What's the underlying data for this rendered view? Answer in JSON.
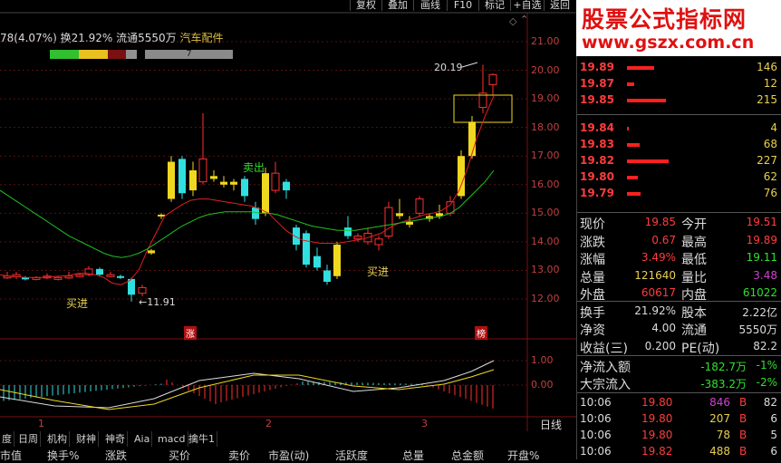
{
  "toolbar": {
    "buttons": [
      "复权",
      "叠加",
      "画线",
      "F10",
      "标记",
      "+自选",
      "返回"
    ]
  },
  "info": {
    "prefix": "78(4.07%) 换21.92% 流通5550万",
    "sector": "汽车配件"
  },
  "strip": {
    "label": "7"
  },
  "price_axis": [
    "21.00",
    "20.00",
    "19.00",
    "18.00",
    "17.00",
    "16.00",
    "15.00",
    "14.00",
    "13.00",
    "12.00"
  ],
  "macd_axis": [
    "1.00",
    "0.00"
  ],
  "annotations": {
    "high": "20.19",
    "low": "11.91",
    "buy1": "买进",
    "sell": "卖出",
    "buy2": "买进",
    "zhang": "涨",
    "bang": "榜"
  },
  "date_marks": [
    "1",
    "2",
    "3"
  ],
  "period_label": "日线",
  "bottom_tabs": [
    "度",
    "日周",
    "机构",
    "财神",
    "神奇",
    "Aia",
    "macd",
    "擒牛1"
  ],
  "columns": [
    "市值",
    "换手%",
    "涨跌",
    "买价",
    "卖价",
    "市盈(动)",
    "活跃度",
    "总量",
    "总金额",
    "开盘%"
  ],
  "logo": {
    "title": "股票公式指标网",
    "url": "www.gszx.com.cn"
  },
  "orderbook": [
    {
      "price": "19.89",
      "bar": 0.3,
      "vol": "146"
    },
    {
      "price": "19.87",
      "bar": 0.08,
      "vol": "12"
    },
    {
      "price": "19.85",
      "bar": 0.43,
      "vol": "215"
    },
    {
      "price": "19.84",
      "bar": 0.02,
      "vol": "4"
    },
    {
      "price": "19.83",
      "bar": 0.14,
      "vol": "68"
    },
    {
      "price": "19.82",
      "bar": 0.46,
      "vol": "227"
    },
    {
      "price": "19.80",
      "bar": 0.12,
      "vol": "62"
    },
    {
      "price": "19.79",
      "bar": 0.15,
      "vol": "76"
    }
  ],
  "quote": [
    {
      "l": "现价",
      "lv": "19.85",
      "lc": "#ff3c3c",
      "r": "今开",
      "rv": "19.51",
      "rc": "#ff3c3c"
    },
    {
      "l": "涨跌",
      "lv": "0.67",
      "lc": "#ff3c3c",
      "r": "最高",
      "rv": "19.89",
      "rc": "#ff3c3c"
    },
    {
      "l": "涨幅",
      "lv": "3.49%",
      "lc": "#ff3c3c",
      "r": "最低",
      "rv": "19.11",
      "rc": "#30e030"
    },
    {
      "l": "总量",
      "lv": "121640",
      "lc": "#e8d050",
      "r": "量比",
      "rv": "3.48",
      "rc": "#d040d0"
    },
    {
      "l": "外盘",
      "lv": "60617",
      "lc": "#ff3c3c",
      "r": "内盘",
      "rv": "61022",
      "rc": "#30e030"
    },
    {
      "l": "换手",
      "lv": "21.92%",
      "lc": "#dcdcdc",
      "r": "股本",
      "rv": "2.22亿",
      "rc": "#dcdcdc"
    },
    {
      "l": "净资",
      "lv": "4.00",
      "lc": "#dcdcdc",
      "r": "流通",
      "rv": "5550万",
      "rc": "#dcdcdc"
    },
    {
      "l": "收益(三)",
      "lv": "0.200",
      "lc": "#dcdcdc",
      "r": "PE(动)",
      "rv": "82.2",
      "rc": "#dcdcdc"
    }
  ],
  "flows": [
    {
      "label": "净流入额",
      "value": "-182.7万",
      "pct": "-1%"
    },
    {
      "label": "大宗流入",
      "value": "-383.2万",
      "pct": "-2%"
    }
  ],
  "ticks": [
    {
      "time": "10:06",
      "price": "19.80",
      "vol": "846",
      "vc": "#d040d0",
      "bs": "B",
      "n": "82"
    },
    {
      "time": "10:06",
      "price": "19.80",
      "vol": "207",
      "vc": "#e8d050",
      "bs": "B",
      "n": "6"
    },
    {
      "time": "10:06",
      "price": "19.80",
      "vol": "78",
      "vc": "#e8d050",
      "bs": "B",
      "n": "5"
    },
    {
      "time": "10:06",
      "price": "19.82",
      "vol": "488",
      "vc": "#e8d050",
      "bs": "B",
      "n": "6"
    }
  ],
  "chart_data": {
    "type": "candlestick",
    "ylim": [
      11.5,
      21.3
    ],
    "ma_red": [
      12.85,
      12.8,
      12.78,
      12.75,
      12.75,
      12.75,
      12.78,
      12.8,
      12.82,
      12.9,
      12.9,
      12.85,
      12.75,
      12.55,
      12.5,
      12.65,
      13.0,
      13.7,
      14.3,
      14.9,
      15.1,
      15.3,
      15.45,
      15.5,
      15.5,
      15.45,
      15.4,
      15.35,
      15.3,
      15.25,
      15.15,
      15.0,
      14.7,
      14.4,
      14.2,
      14.05,
      14.0,
      13.95,
      13.95,
      13.95,
      14.0,
      14.05,
      14.1,
      14.2,
      14.3,
      14.5,
      14.65,
      14.75,
      14.85,
      14.95,
      15.0,
      15.1,
      15.3,
      15.8,
      16.6,
      17.6,
      18.4,
      19.1
    ],
    "ma_green": [
      15.8,
      15.6,
      15.4,
      15.2,
      15.0,
      14.8,
      14.6,
      14.4,
      14.2,
      14.05,
      13.9,
      13.75,
      13.6,
      13.5,
      13.45,
      13.5,
      13.6,
      13.75,
      13.95,
      14.15,
      14.35,
      14.55,
      14.7,
      14.85,
      14.95,
      15.0,
      15.05,
      15.05,
      15.05,
      15.05,
      15.0,
      15.0,
      14.95,
      14.85,
      14.75,
      14.65,
      14.55,
      14.5,
      14.45,
      14.4,
      14.4,
      14.4,
      14.45,
      14.5,
      14.55,
      14.6,
      14.65,
      14.7,
      14.75,
      14.8,
      14.85,
      14.9,
      15.0,
      15.2,
      15.5,
      15.8,
      16.1,
      16.5
    ]
  }
}
